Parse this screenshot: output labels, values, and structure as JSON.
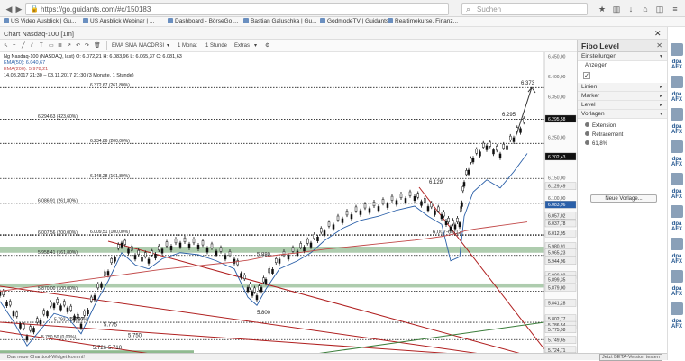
{
  "browser": {
    "url": "https://go.guidants.com/#c/150183",
    "search_placeholder": "Suchen",
    "bookmarks": [
      "US Video Ausblick | Gu...",
      "US Ausblick Webinar | ...",
      "Dashboard - BörseGo ...",
      "Bastian Galuschka | Gu...",
      "GodmodeTV | Guidants",
      "Realtimekurse, Finanz..."
    ]
  },
  "window": {
    "title": "Chart Nasdaq-100 [1m]"
  },
  "toolbar": {
    "items": [
      "EMA",
      "SMA",
      "MACD",
      "RSI",
      "1 Monat",
      "1 Stunde",
      "Extras"
    ]
  },
  "legend": {
    "line1": "Ng Nasdaq-100 (NASDAQ, last)   O: 6.072,21  H: 6.083,96  L: 6.065,37  C: 6.081,63",
    "line2": "EMA(50): 6.040,67",
    "line3": "EMA(200): 5.978,21",
    "line4": "14.08.2017 21:30 – 03.11.2017 21:30     (3 Monate, 1 Stunde)"
  },
  "chart_data": {
    "type": "candlestick",
    "y_ticks": [
      "6.450,00",
      "6.400,00",
      "6.350,00",
      "6.300,00",
      "6.250,00",
      "6.200,00",
      "6.150,00",
      "6.100,00",
      "6.050,00"
    ],
    "fib_levels": [
      {
        "label": "6.372,67 (261,80%)",
        "value": 6372.67
      },
      {
        "label": "6.294,63 (423,60%)",
        "value": 6294.63
      },
      {
        "label": "6.234,86 (200,00%)",
        "value": 6234.86
      },
      {
        "label": "6.148,28 (161,80%)",
        "value": 6148.28
      },
      {
        "label": "6.086,91 (261,80%)",
        "value": 6086.91
      },
      {
        "label": "6.007,56 (200,00%)",
        "value": 6007.56
      },
      {
        "label": "6.009,51 (100,00%)",
        "value": 6009.51
      },
      {
        "label": "5.958,41 (161,80%)",
        "value": 5958.41
      },
      {
        "label": "5.870,00 (100,00%)",
        "value": 5870.0
      },
      {
        "label": "5.793,22 (0,00%)",
        "value": 5793.22
      },
      {
        "label": "5.750,50 (0,00%)",
        "value": 5750.5
      }
    ],
    "annotations": [
      "6.373",
      "6.295",
      "6.129",
      "6.007-6.012",
      "5.880",
      "5.800",
      "5.787",
      "5.775",
      "5.750",
      "5.726-5.710"
    ],
    "price_labels": [
      {
        "text": "6.295,58",
        "bg": "#111111",
        "fg": "#ffffff"
      },
      {
        "text": "6.202,43",
        "bg": "#111111",
        "fg": "#ffffff"
      },
      {
        "text": "6.129,49",
        "bg": "#eeeeee",
        "fg": "#333333"
      },
      {
        "text": "6.083,96",
        "bg": "#2a5fa8",
        "fg": "#ffffff"
      },
      {
        "text": "6.057,02",
        "bg": "#eeeeee",
        "fg": "#333333"
      },
      {
        "text": "6.037,78",
        "bg": "#eeeeee",
        "fg": "#333333"
      },
      {
        "text": "6.012,95",
        "bg": "#eeeeee",
        "fg": "#333333"
      },
      {
        "text": "5.980,91",
        "bg": "#eeeeee",
        "fg": "#333333"
      },
      {
        "text": "5.965,23",
        "bg": "#eeeeee",
        "fg": "#333333"
      },
      {
        "text": "5.944,96",
        "bg": "#eeeeee",
        "fg": "#333333"
      },
      {
        "text": "5.909,92",
        "bg": "#eeeeee",
        "fg": "#333333"
      },
      {
        "text": "5.899,35",
        "bg": "#eeeeee",
        "fg": "#333333"
      },
      {
        "text": "5.879,00",
        "bg": "#eeeeee",
        "fg": "#333333"
      },
      {
        "text": "5.841,28",
        "bg": "#eeeeee",
        "fg": "#333333"
      },
      {
        "text": "5.802,77",
        "bg": "#eeeeee",
        "fg": "#333333"
      },
      {
        "text": "5.786,54",
        "bg": "#eeeeee",
        "fg": "#333333"
      },
      {
        "text": "5.775,98",
        "bg": "#eeeeee",
        "fg": "#333333"
      },
      {
        "text": "5.749,65",
        "bg": "#eeeeee",
        "fg": "#333333"
      },
      {
        "text": "5.724,71",
        "bg": "#eeeeee",
        "fg": "#333333"
      },
      {
        "text": "5.709,60",
        "bg": "#eeeeee",
        "fg": "#333333"
      }
    ]
  },
  "panel": {
    "title": "Fibo Level",
    "sections": [
      "Einstellungen",
      "Anzeigen",
      "Linien",
      "Marker",
      "Level",
      "Vorlagen"
    ],
    "templates": [
      "Extension",
      "Retracement",
      "61,8%"
    ],
    "new_button": "Neue Vorlage..."
  },
  "avatars": [
    "dpa AFX",
    "dpa AFX",
    "dpa AFX",
    "dpa AFX",
    "dpa AFX",
    "dpa AFX",
    "dpa AFX",
    "dpa AFX",
    "dpa AFX"
  ],
  "status": {
    "left": "Das neue Charttool-Widget kommt!",
    "right": "Jetzt BETA-Version testen"
  },
  "colors": {
    "up": "#111111",
    "zone": "#6ba36b",
    "trend_red": "#b02020",
    "ema50": "#2a5fa8",
    "ema200": "#c24a4a"
  }
}
